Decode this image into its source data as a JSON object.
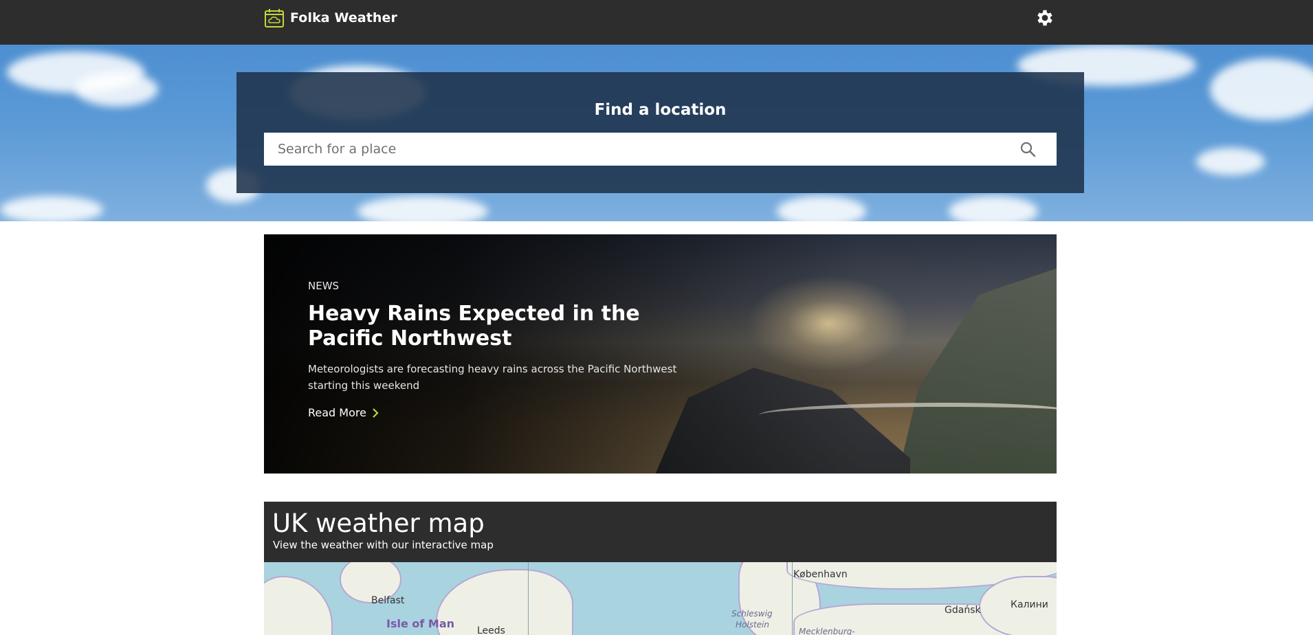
{
  "header": {
    "brand_name": "Folka Weather",
    "brand_icon": "calendar-cloud-icon",
    "settings_icon": "gear-icon",
    "brand_color": "#c6d63c"
  },
  "search": {
    "title": "Find a location",
    "placeholder": "Search for a place",
    "button_icon": "search-icon"
  },
  "news": {
    "tag": "NEWS",
    "title": "Heavy Rains Expected in the Pacific Northwest",
    "description": "Meteorologists are forecasting heavy rains across the Pacific Northwest starting this weekend",
    "read_more": "Read More",
    "chevron_color": "#c6d63c"
  },
  "map": {
    "title": "UK weather map",
    "subtitle": "View the weather with our interactive map",
    "labels": {
      "belfast": "Belfast",
      "isle_of_man": "Isle of Man",
      "leeds": "Leeds",
      "kobenhavn": "København",
      "schleswig": "Schleswig",
      "holstein": "Holstein",
      "mecklenburg": "Mecklenburg-",
      "gdansk": "Gdańsk",
      "kalini": "Калини"
    }
  }
}
